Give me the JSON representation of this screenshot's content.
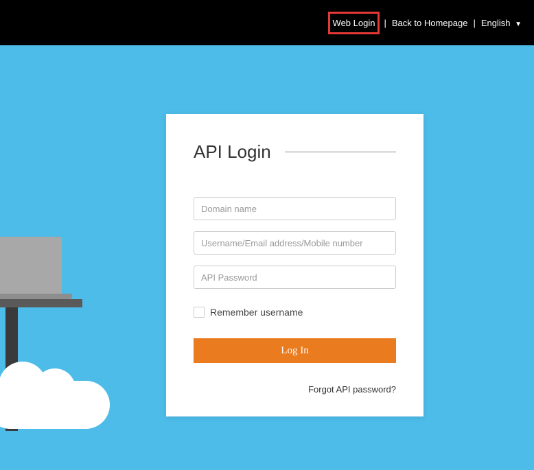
{
  "topbar": {
    "web_login": "Web Login",
    "back_home": "Back to Homepage",
    "language": "English"
  },
  "login": {
    "title": "API Login",
    "domain_placeholder": "Domain name",
    "username_placeholder": "Username/Email address/Mobile number",
    "password_placeholder": "API Password",
    "remember_label": "Remember username",
    "login_button": "Log In",
    "forgot_link": "Forgot API password?"
  }
}
